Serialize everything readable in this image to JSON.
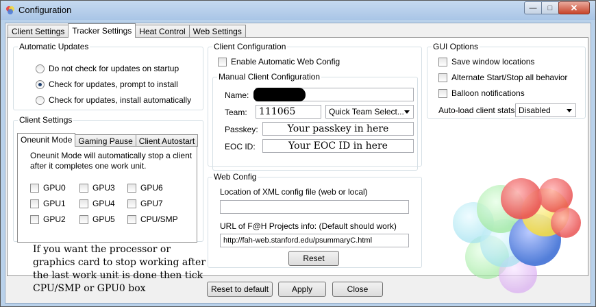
{
  "window": {
    "title": "Configuration",
    "min_label": "—",
    "max_label": "□",
    "close_label": "✕"
  },
  "tabs": [
    {
      "label": "Client Settings"
    },
    {
      "label": "Tracker Settings"
    },
    {
      "label": "Heat Control"
    },
    {
      "label": "Web Settings"
    }
  ],
  "automatic_updates": {
    "legend": "Automatic Updates",
    "options": [
      {
        "label": "Do not check for updates on startup",
        "selected": false
      },
      {
        "label": "Check for updates, prompt to install",
        "selected": true
      },
      {
        "label": "Check for updates, install automatically",
        "selected": false
      }
    ]
  },
  "client_settings": {
    "legend": "Client Settings",
    "subtabs": [
      {
        "label": "Oneunit Mode"
      },
      {
        "label": "Gaming Pause"
      },
      {
        "label": "Client Autostart"
      }
    ],
    "description": "Oneunit Mode will automatically stop a client after it completes one work unit.",
    "checkboxes": [
      "GPU0",
      "GPU1",
      "GPU2",
      "GPU3",
      "GPU4",
      "GPU5",
      "GPU6",
      "GPU7",
      "CPU/SMP"
    ]
  },
  "note": "If you want the processor or graphics card to stop working after the last work unit is done then tick CPU/SMP or GPU0 box",
  "client_configuration": {
    "legend": "Client Configuration",
    "enable_web_config_label": "Enable Automatic Web Config",
    "manual_legend": "Manual Client Configuration",
    "name_label": "Name:",
    "team_label": "Team:",
    "team_value": "111065",
    "quick_team_label": "Quick Team Select...",
    "passkey_label": "Passkey:",
    "passkey_value": "Your passkey in here",
    "eoc_label": "EOC ID:",
    "eoc_value": "Your EOC ID in here"
  },
  "web_config": {
    "legend": "Web Config",
    "xml_label": "Location of XML config file (web or local)",
    "xml_value": "",
    "url_label": "URL of F@H Projects info: (Default should work)",
    "url_value": "http://fah-web.stanford.edu/psummaryC.html",
    "reset_label": "Reset"
  },
  "gui_options": {
    "legend": "GUI Options",
    "checkboxes": [
      "Save window locations",
      "Alternate Start/Stop all behavior",
      "Balloon notifications"
    ],
    "autoload_label": "Auto-load client stats:",
    "autoload_value": "Disabled"
  },
  "footer": {
    "reset_default_label": "Reset to default",
    "apply_label": "Apply",
    "close_label": "Close"
  },
  "colors": {
    "logo": [
      "#e84a4a",
      "#f2d93c",
      "#4a78d8",
      "#6dd86d",
      "#3cc6e0",
      "#c85ae0"
    ]
  }
}
